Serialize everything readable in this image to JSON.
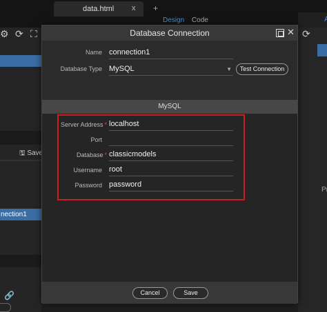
{
  "editor": {
    "doc_tab": "data.html",
    "doc_tab_close": "x",
    "new_tab": "+",
    "view_design": "Design",
    "view_code": "Code",
    "right_partial_letter": "A",
    "left_save_label": "Save",
    "left_connection_label": "nection1",
    "right_partial_text": "Pr"
  },
  "dialog": {
    "title": "Database Connection",
    "name_label": "Name",
    "name_value": "connection1",
    "db_type_label": "Database Type",
    "db_type_value": "MySQL",
    "test_button": "Test Connection",
    "section_title": "MySQL",
    "fields": [
      {
        "label": "Server Address",
        "required": true,
        "value": "localhost"
      },
      {
        "label": "Port",
        "required": false,
        "value": ""
      },
      {
        "label": "Database",
        "required": true,
        "value": "classicmodels"
      },
      {
        "label": "Username",
        "required": false,
        "value": "root"
      },
      {
        "label": "Password",
        "required": false,
        "value": "password"
      }
    ],
    "cancel_button": "Cancel",
    "save_button": "Save"
  },
  "icons": {
    "close": "close-icon",
    "maximize": "maximize-icon",
    "select_arrow": "chevron-down-icon"
  },
  "colors": {
    "accent": "#4a8fd6",
    "highlight": "#d01c1c",
    "required": "#e04545"
  }
}
